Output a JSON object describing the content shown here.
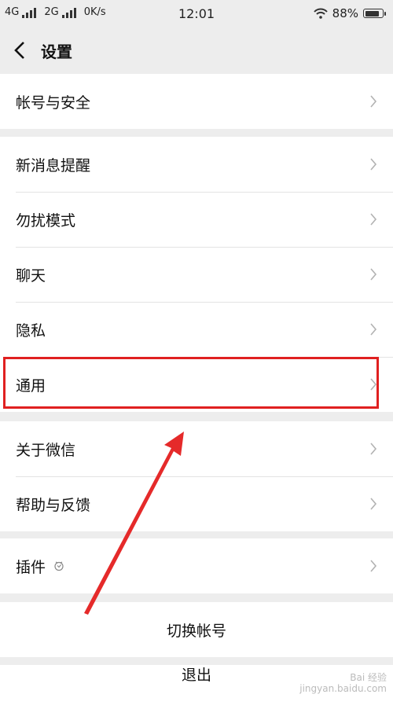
{
  "status_bar": {
    "net1": "4G",
    "net2": "2G",
    "speed": "0K/s",
    "time": "12:01",
    "battery_percent": "88%",
    "battery_level": 0.88
  },
  "header": {
    "title": "设置"
  },
  "groups": [
    {
      "items": [
        {
          "label": "帐号与安全"
        }
      ]
    },
    {
      "items": [
        {
          "label": "新消息提醒"
        },
        {
          "label": "勿扰模式"
        },
        {
          "label": "聊天"
        },
        {
          "label": "隐私"
        },
        {
          "label": "通用"
        }
      ]
    },
    {
      "items": [
        {
          "label": "关于微信"
        },
        {
          "label": "帮助与反馈"
        }
      ]
    },
    {
      "items": [
        {
          "label": "插件"
        }
      ]
    }
  ],
  "actions": {
    "switch_account": "切换帐号",
    "logout": "退出"
  },
  "watermark": {
    "line1": "Bai 经验",
    "line2": "jingyan.baidu.com"
  },
  "colors": {
    "annotation": "#e02020",
    "background": "#ededed"
  }
}
